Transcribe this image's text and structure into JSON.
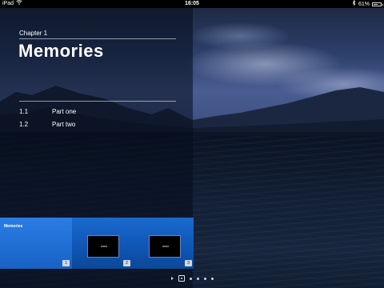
{
  "status": {
    "carrier": "iPad",
    "time": "16:05",
    "battery_text": "61%",
    "battery_level": 0.61
  },
  "chapter": {
    "label": "Chapter 1",
    "title": "Memories"
  },
  "toc": [
    {
      "num": "1.1",
      "label": "Part one"
    },
    {
      "num": "1.2",
      "label": "Part two"
    }
  ],
  "thumbnails": [
    {
      "title": "Memories",
      "page": "1"
    },
    {
      "page": "2"
    },
    {
      "page": "3"
    }
  ],
  "page_indicator": {
    "total_dots": 4,
    "current": 0
  },
  "colors": {
    "strip_blue": "#1762c4",
    "overlay": "#060c1c"
  }
}
